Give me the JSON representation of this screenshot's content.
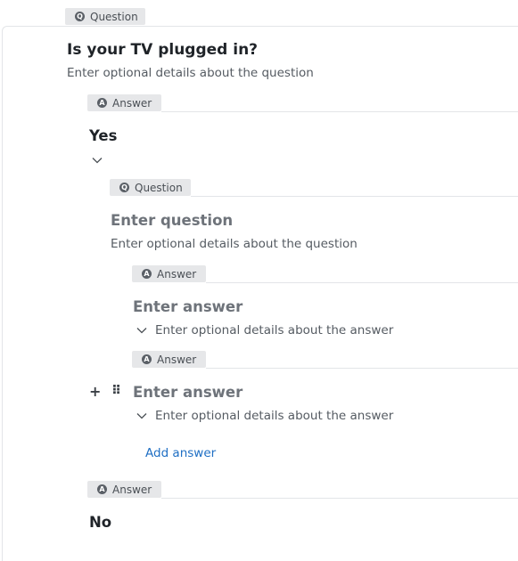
{
  "root_question": {
    "tag": "Question",
    "title": "Is your TV plugged in?",
    "description_placeholder": "Enter optional details about the question"
  },
  "answer_yes": {
    "tag": "Answer",
    "title": "Yes"
  },
  "nested_question": {
    "tag": "Question",
    "title_placeholder": "Enter question",
    "description_placeholder": "Enter optional details about the question",
    "answers": [
      {
        "tag": "Answer",
        "title_placeholder": "Enter answer",
        "description_placeholder": "Enter optional details about the answer"
      },
      {
        "tag": "Answer",
        "title_placeholder": "Enter answer",
        "description_placeholder": "Enter optional details about the answer"
      }
    ],
    "add_answer_label": "Add answer"
  },
  "answer_no": {
    "tag": "Answer",
    "title": "No"
  },
  "icons": {
    "question_tag_icon": "Q",
    "answer_tag_icon": "A",
    "add_icon": "+",
    "drag_icon": "⠿"
  },
  "colors": {
    "link": "#1f6fc4",
    "tag_bg": "#e6e7e9"
  }
}
